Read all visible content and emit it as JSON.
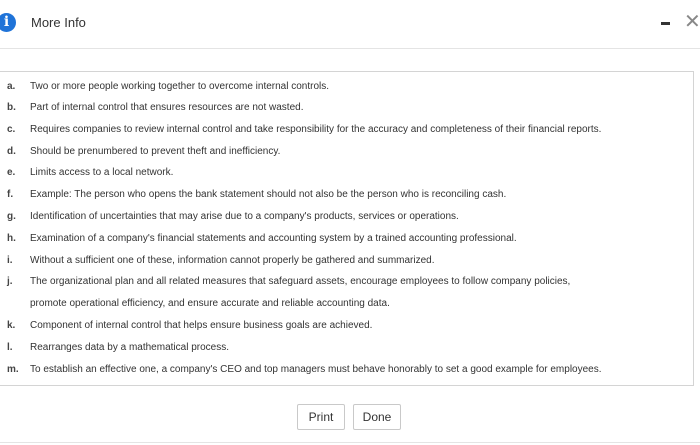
{
  "dialog": {
    "title": "More Info",
    "info_icon": "i",
    "minimize_icon": "minimize-icon",
    "close_icon": "✕"
  },
  "items": [
    {
      "letter": "a.",
      "text": "Two or more people working together to overcome internal controls."
    },
    {
      "letter": "b.",
      "text": "Part of internal control that ensures resources are not wasted."
    },
    {
      "letter": "c.",
      "text": "Requires companies to review internal control and take responsibility for the accuracy and completeness of their financial reports."
    },
    {
      "letter": "d.",
      "text": "Should be prenumbered to prevent theft and inefficiency."
    },
    {
      "letter": "e.",
      "text": "Limits access to a local network."
    },
    {
      "letter": "f.",
      "text": "Example: The person who opens the bank statement should not also be the person who is reconciling cash."
    },
    {
      "letter": "g.",
      "text": "Identification of uncertainties that may arise due to a company's products, services or operations."
    },
    {
      "letter": "h.",
      "text": "Examination of a company's financial statements and accounting system by a trained accounting professional."
    },
    {
      "letter": "i.",
      "text": "Without a sufficient one of these, information cannot properly be gathered and summarized."
    },
    {
      "letter": "j.",
      "text": "The organizational plan and all related measures that safeguard assets, encourage employees to follow company policies,"
    },
    {
      "letter": "",
      "text": "promote operational efficiency, and ensure accurate and reliable accounting data."
    },
    {
      "letter": "k.",
      "text": "Component of internal control that helps ensure business goals are achieved."
    },
    {
      "letter": "l.",
      "text": "Rearranges data by a mathematical process."
    },
    {
      "letter": "m.",
      "text": "To establish an effective one, a company's CEO and top managers must behave honorably to set a good example for employees."
    }
  ],
  "buttons": {
    "print_label": "Print",
    "done_label": "Done"
  }
}
